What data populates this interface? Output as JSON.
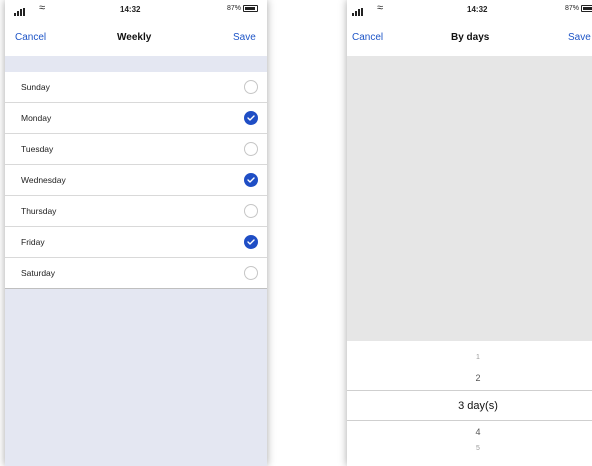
{
  "left": {
    "status": {
      "time": "14:32",
      "battery": "87%"
    },
    "nav": {
      "cancel": "Cancel",
      "title": "Weekly",
      "save": "Save"
    },
    "days": [
      {
        "label": "Sunday",
        "checked": false
      },
      {
        "label": "Monday",
        "checked": true
      },
      {
        "label": "Tuesday",
        "checked": false
      },
      {
        "label": "Wednesday",
        "checked": true
      },
      {
        "label": "Thursday",
        "checked": false
      },
      {
        "label": "Friday",
        "checked": true
      },
      {
        "label": "Saturday",
        "checked": false
      }
    ]
  },
  "right": {
    "status": {
      "time": "14:32",
      "battery": "87%"
    },
    "nav": {
      "cancel": "Cancel",
      "title": "By days",
      "save": "Save"
    },
    "picker": {
      "items": [
        "1",
        "2",
        "3 day(s)",
        "4",
        "5"
      ],
      "selected": "3 day(s)"
    }
  },
  "colors": {
    "accent": "#1f4ec5",
    "link": "#1e55c7",
    "list_background": "#e4e7f2"
  }
}
